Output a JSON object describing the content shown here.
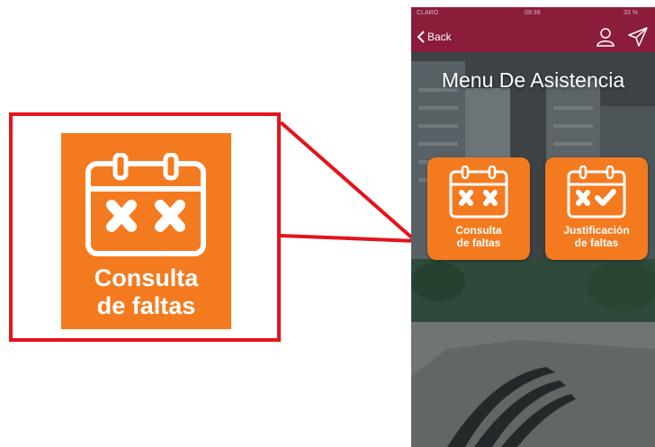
{
  "callout": {
    "tile_label_line1": "Consulta",
    "tile_label_line2": "de faltas",
    "tile_icon": "calendar-x-icon"
  },
  "phone": {
    "status_bar": {
      "carrier": "CLARO",
      "time": "09:39",
      "battery": "33 %"
    },
    "nav": {
      "back_label": "Back",
      "icons": [
        "user-icon",
        "send-icon"
      ]
    },
    "title": "Menu De Asistencia",
    "tiles": [
      {
        "line1": "Consulta",
        "line2": "de faltas",
        "icon": "calendar-x-icon"
      },
      {
        "line1": "Justificación",
        "line2": "de faltas",
        "icon": "calendar-check-icon"
      }
    ]
  },
  "colors": {
    "accent_orange": "#f47a20",
    "header_maroon": "#8c1d3a",
    "callout_red": "#e4141b"
  }
}
